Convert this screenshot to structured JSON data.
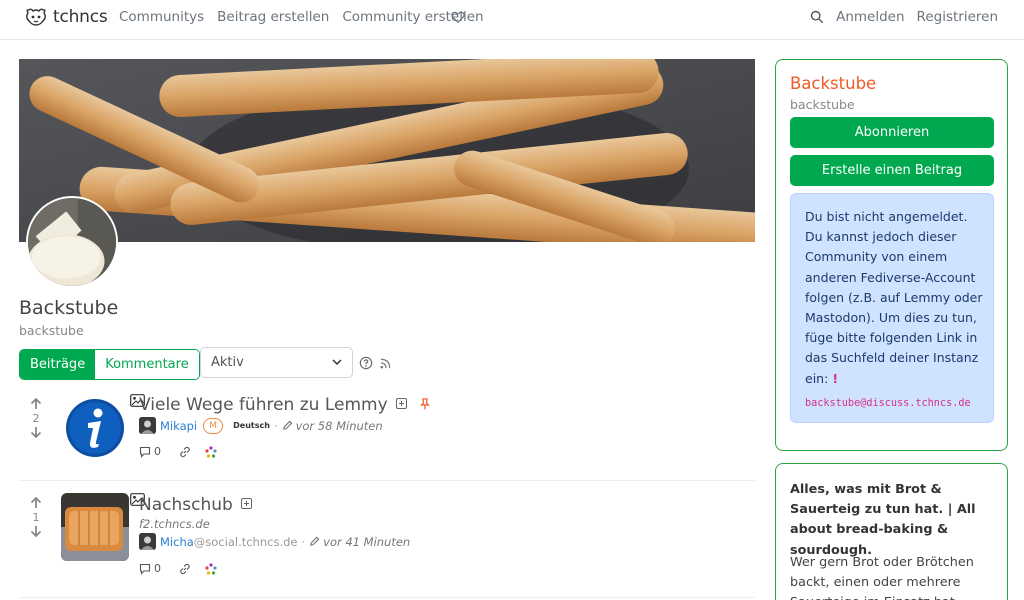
{
  "brand": {
    "name": "tchncs"
  },
  "nav": {
    "links": [
      "Communitys",
      "Beitrag erstellen",
      "Community erstellen"
    ],
    "login": "Anmelden",
    "register": "Registrieren"
  },
  "community": {
    "title": "Backstube",
    "name": "backstube"
  },
  "controls": {
    "tab_posts": "Beiträge",
    "tab_comments": "Kommentare",
    "sort_value": "Aktiv"
  },
  "posts": [
    {
      "score": "2",
      "title": "Viele Wege führen zu Lemmy",
      "user": "Mikapi",
      "mod_badge": "M",
      "language": "Deutsch",
      "time": "vor 58 Minuten",
      "comments": "0"
    },
    {
      "score": "1",
      "title": "Nachschub",
      "domain": "f2.tchncs.de",
      "user": "Micha",
      "instance": "@social.tchncs.de",
      "time": "vor 41 Minuten",
      "comments": "0"
    }
  ],
  "sidebar": {
    "title": "Backstube",
    "subtitle": "backstube",
    "subscribe": "Abonnieren",
    "create_post": "Erstelle einen Beitrag",
    "notice": "Du bist nicht angemeldet. Du kannst jedoch dieser Community von einem anderen Fediverse-Account folgen (z.B. auf Lemmy oder Mastodon). Um dies zu tun, füge bitte folgenden Link in das Suchfeld deiner Instanz ein:",
    "notice_mark": "!",
    "handle": "backstube@discuss.tchncs.de",
    "desc_bold": "Alles, was mit Brot & Sauerteig zu tun hat. | All about bread-baking & sourdough.",
    "desc_text": "Wer gern Brot oder Brötchen backt, einen oder mehrere Sauerteige im Einsatz hat"
  },
  "colors": {
    "accent": "#00a84f",
    "title_orange": "#f05a28",
    "info_bg": "#cfe2ff"
  }
}
